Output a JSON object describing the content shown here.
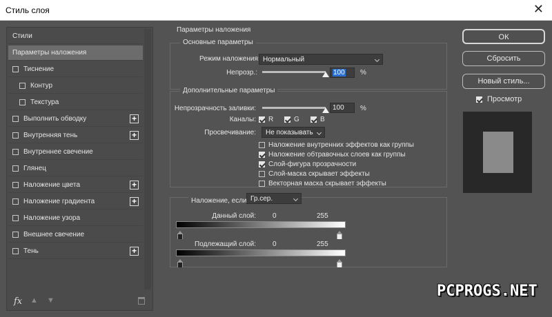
{
  "window": {
    "title": "Стиль слоя",
    "close": "✕"
  },
  "left_panel": {
    "items": [
      {
        "label": "Стили",
        "checkbox": false,
        "plus": false,
        "selected": false,
        "indent": 0
      },
      {
        "label": "Параметры наложения",
        "checkbox": false,
        "plus": false,
        "selected": true,
        "indent": 0
      },
      {
        "label": "Тиснение",
        "checkbox": true,
        "plus": false,
        "selected": false,
        "indent": 0
      },
      {
        "label": "Контур",
        "checkbox": true,
        "plus": false,
        "selected": false,
        "indent": 1
      },
      {
        "label": "Текстура",
        "checkbox": true,
        "plus": false,
        "selected": false,
        "indent": 1
      },
      {
        "label": "Выполнить обводку",
        "checkbox": true,
        "plus": true,
        "selected": false,
        "indent": 0
      },
      {
        "label": "Внутренняя тень",
        "checkbox": true,
        "plus": true,
        "selected": false,
        "indent": 0
      },
      {
        "label": "Внутреннее свечение",
        "checkbox": true,
        "plus": false,
        "selected": false,
        "indent": 0
      },
      {
        "label": "Глянец",
        "checkbox": true,
        "plus": false,
        "selected": false,
        "indent": 0
      },
      {
        "label": "Наложение цвета",
        "checkbox": true,
        "plus": true,
        "selected": false,
        "indent": 0
      },
      {
        "label": "Наложение градиента",
        "checkbox": true,
        "plus": true,
        "selected": false,
        "indent": 0
      },
      {
        "label": "Наложение узора",
        "checkbox": true,
        "plus": false,
        "selected": false,
        "indent": 0
      },
      {
        "label": "Внешнее свечение",
        "checkbox": true,
        "plus": false,
        "selected": false,
        "indent": 0
      },
      {
        "label": "Тень",
        "checkbox": true,
        "plus": true,
        "selected": false,
        "indent": 0
      }
    ],
    "toolbar": {
      "fx": "fx",
      "up": "▲",
      "down": "▼"
    }
  },
  "blending": {
    "section_title": "Параметры наложения",
    "general": {
      "title": "Основные параметры",
      "mode_label": "Режим наложения:",
      "mode_value": "Нормальный",
      "opacity_label": "Непрозр.:",
      "opacity_value": "100",
      "opacity_level": 1.0,
      "percent": "%"
    },
    "advanced": {
      "title": "Дополнительные параметры",
      "fill_label": "Непрозрачность заливки:",
      "fill_value": "100",
      "fill_level": 1.0,
      "percent": "%",
      "channels_label": "Каналы:",
      "channels": [
        {
          "label": "R",
          "checked": true
        },
        {
          "label": "G",
          "checked": true
        },
        {
          "label": "B",
          "checked": true
        }
      ],
      "knockout_label": "Просвечивание:",
      "knockout_value": "Не показывать",
      "options": [
        {
          "label": "Наложение внутренних эффектов как группы",
          "checked": false
        },
        {
          "label": "Наложение обтравочных слоев как группы",
          "checked": true
        },
        {
          "label": "Слой-фигура прозрачности",
          "checked": true
        },
        {
          "label": "Слой-маска скрывает эффекты",
          "checked": false
        },
        {
          "label": "Векторная маска скрывает эффекты",
          "checked": false
        }
      ]
    },
    "blend_if": {
      "label": "Наложение, если:",
      "value": "Гр.сер.",
      "this_layer_label": "Данный слой:",
      "this_min": "0",
      "this_max": "255",
      "underlying_label": "Подлежащий слой:",
      "under_min": "0",
      "under_max": "255"
    }
  },
  "buttons": {
    "ok": "ОК",
    "reset": "Сбросить",
    "new_style": "Новый стиль...",
    "preview_label": "Просмотр",
    "preview_checked": true
  },
  "watermark": "PCPROGS.NET",
  "colors": {
    "bg": "#535353",
    "selected_item": "#6c6c6c",
    "highlight": "#2b6fd1"
  }
}
